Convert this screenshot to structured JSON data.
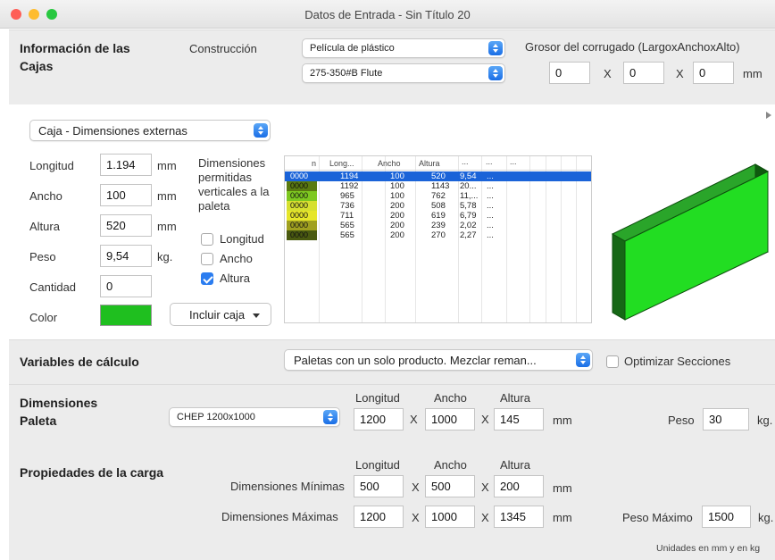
{
  "window": {
    "title": "Datos de Entrada - Sin Título 20"
  },
  "cajas": {
    "heading": "Información de las Cajas",
    "construccion_label": "Construcción",
    "construccion_value": "Película de plástico",
    "flute_value": "275-350#B Flute",
    "grosor_label": "Grosor del corrugado (LargoxAnchoxAlto)",
    "grosor_values": [
      "0",
      "0",
      "0"
    ],
    "x_sep": "X",
    "mm": "mm"
  },
  "caja_dim": {
    "popup": "Caja - Dimensiones externas",
    "fields": [
      {
        "label": "Longitud",
        "value": "1.194",
        "unit": "mm"
      },
      {
        "label": "Ancho",
        "value": "100",
        "unit": "mm"
      },
      {
        "label": "Altura",
        "value": "520",
        "unit": "mm"
      },
      {
        "label": "Peso",
        "value": "9,54",
        "unit": "kg."
      },
      {
        "label": "Cantidad",
        "value": "0",
        "unit": ""
      }
    ],
    "color_label": "Color",
    "color_hex": "#1fbf1f",
    "permitidas_label": "Dimensiones permitidas verticales a la paleta",
    "checks": [
      {
        "label": "Longitud",
        "checked": false
      },
      {
        "label": "Ancho",
        "checked": false
      },
      {
        "label": "Altura",
        "checked": true
      }
    ],
    "incluir_label": "Incluir caja"
  },
  "table": {
    "headers": [
      "n",
      "Long...",
      "Ancho",
      "Altura",
      "...",
      "...",
      "..."
    ],
    "rows": [
      {
        "n": "0000",
        "color": "#1a63d8",
        "long": "1194",
        "ancho": "100",
        "altura": "520",
        "peso": "9,54",
        "extra": "..."
      },
      {
        "n": "0000",
        "color": "#5a7a10",
        "long": "1192",
        "ancho": "100",
        "altura": "1143",
        "peso": "20...",
        "extra": "..."
      },
      {
        "n": "0000",
        "color": "#7ec820",
        "long": "965",
        "ancho": "100",
        "altura": "762",
        "peso": "11,...",
        "extra": "..."
      },
      {
        "n": "0000",
        "color": "#d6e030",
        "long": "736",
        "ancho": "200",
        "altura": "508",
        "peso": "5,78",
        "extra": "..."
      },
      {
        "n": "0000",
        "color": "#e6e62a",
        "long": "711",
        "ancho": "200",
        "altura": "619",
        "peso": "6,79",
        "extra": "..."
      },
      {
        "n": "0000",
        "color": "#a0a020",
        "long": "565",
        "ancho": "200",
        "altura": "239",
        "peso": "2,02",
        "extra": "..."
      },
      {
        "n": "0000",
        "color": "#4a5a10",
        "long": "565",
        "ancho": "200",
        "altura": "270",
        "peso": "2,27",
        "extra": "..."
      }
    ]
  },
  "variables": {
    "heading": "Variables de cálculo",
    "popup": "Paletas con un solo producto. Mezclar reman...",
    "optimizar_label": "Optimizar Secciones",
    "optimizar_checked": false
  },
  "paleta": {
    "heading": "Dimensiones Paleta",
    "popup": "CHEP 1200x1000",
    "col_headers": [
      "Longitud",
      "Ancho",
      "Altura"
    ],
    "values": [
      "1200",
      "1000",
      "145"
    ],
    "x_sep": "X",
    "mm": "mm",
    "peso_label": "Peso",
    "peso_value": "30",
    "kg": "kg."
  },
  "carga": {
    "heading": "Propiedades de la carga",
    "col_headers": [
      "Longitud",
      "Ancho",
      "Altura"
    ],
    "min_label": "Dimensiones Mínimas",
    "min_values": [
      "500",
      "500",
      "200"
    ],
    "max_label": "Dimensiones Máximas",
    "max_values": [
      "1200",
      "1000",
      "1345"
    ],
    "x_sep": "X",
    "mm": "mm",
    "peso_max_label": "Peso Máximo",
    "peso_max_value": "1500",
    "kg": "kg."
  },
  "footer": {
    "units_note": "Unidades en mm y en kg"
  }
}
